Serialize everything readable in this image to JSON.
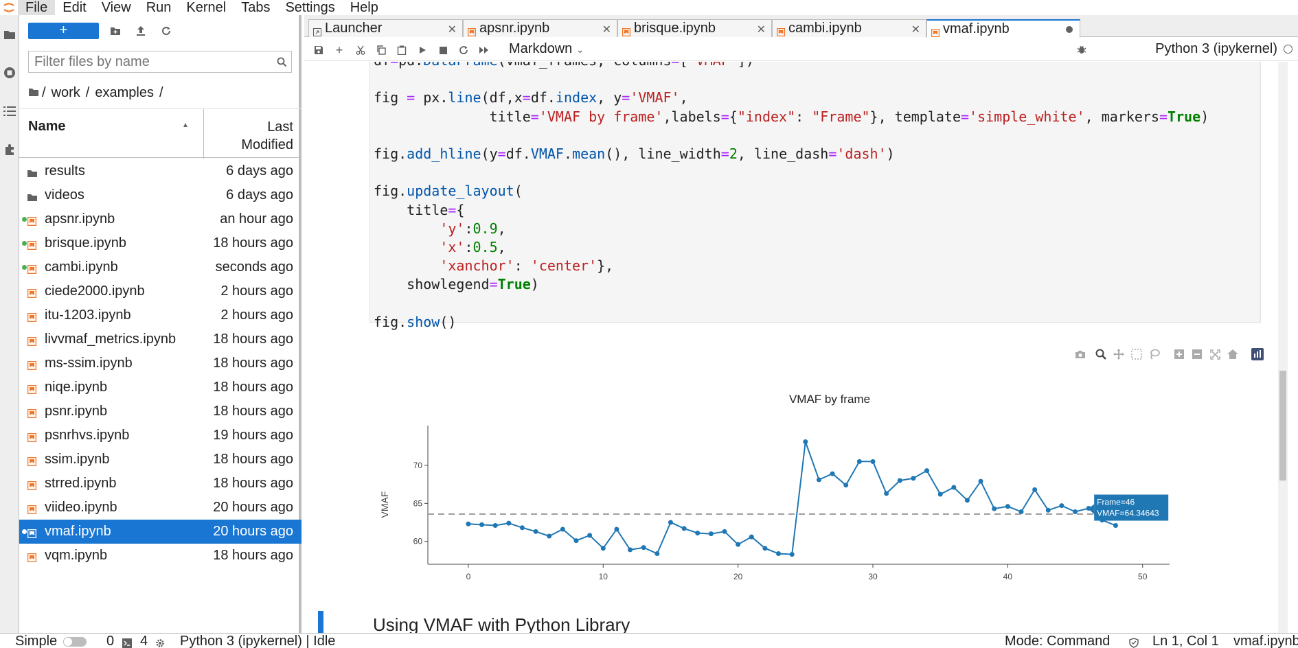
{
  "menubar": {
    "items": [
      "File",
      "Edit",
      "View",
      "Run",
      "Kernel",
      "Tabs",
      "Settings",
      "Help"
    ]
  },
  "filebrowser": {
    "new_label": "+",
    "filter_placeholder": "Filter files by name",
    "breadcrumb": [
      "/",
      "work",
      "/",
      "examples",
      "/"
    ],
    "header_name": "Name",
    "header_modified_line1": "Last",
    "header_modified_line2": "Modified",
    "rows": [
      {
        "name": "results",
        "modified": "6 days ago",
        "type": "folder",
        "running": false
      },
      {
        "name": "videos",
        "modified": "6 days ago",
        "type": "folder",
        "running": false
      },
      {
        "name": "apsnr.ipynb",
        "modified": "an hour ago",
        "type": "notebook",
        "running": true
      },
      {
        "name": "brisque.ipynb",
        "modified": "18 hours ago",
        "type": "notebook",
        "running": true
      },
      {
        "name": "cambi.ipynb",
        "modified": "seconds ago",
        "type": "notebook",
        "running": true
      },
      {
        "name": "ciede2000.ipynb",
        "modified": "2 hours ago",
        "type": "notebook",
        "running": false
      },
      {
        "name": "itu-1203.ipynb",
        "modified": "2 hours ago",
        "type": "notebook",
        "running": false
      },
      {
        "name": "livvmaf_metrics.ipynb",
        "modified": "18 hours ago",
        "type": "notebook",
        "running": false
      },
      {
        "name": "ms-ssim.ipynb",
        "modified": "18 hours ago",
        "type": "notebook",
        "running": false
      },
      {
        "name": "niqe.ipynb",
        "modified": "18 hours ago",
        "type": "notebook",
        "running": false
      },
      {
        "name": "psnr.ipynb",
        "modified": "18 hours ago",
        "type": "notebook",
        "running": false
      },
      {
        "name": "psnrhvs.ipynb",
        "modified": "19 hours ago",
        "type": "notebook",
        "running": false
      },
      {
        "name": "ssim.ipynb",
        "modified": "18 hours ago",
        "type": "notebook",
        "running": false
      },
      {
        "name": "strred.ipynb",
        "modified": "18 hours ago",
        "type": "notebook",
        "running": false
      },
      {
        "name": "viideo.ipynb",
        "modified": "20 hours ago",
        "type": "notebook",
        "running": false
      },
      {
        "name": "vmaf.ipynb",
        "modified": "20 hours ago",
        "type": "notebook",
        "running": true,
        "selected": true
      },
      {
        "name": "vqm.ipynb",
        "modified": "18 hours ago",
        "type": "notebook",
        "running": false
      }
    ]
  },
  "tabs": [
    {
      "label": "Launcher",
      "active": false
    },
    {
      "label": "apsnr.ipynb",
      "active": false
    },
    {
      "label": "brisque.ipynb",
      "active": false
    },
    {
      "label": "cambi.ipynb",
      "active": false
    },
    {
      "label": "vmaf.ipynb",
      "active": true
    }
  ],
  "notebook_toolbar": {
    "cell_type": "Markdown",
    "kernel": "Python 3 (ipykernel)"
  },
  "code_lines": [
    "df=pd.DataFrame(vmaf_frames, columns=['VMAF'])",
    "",
    "fig = px.line(df,x=df.index, y='VMAF',",
    "              title='VMAF by frame',labels={\"index\": \"Frame\"}, template='simple_white', markers=True)",
    "",
    "fig.add_hline(y=df.VMAF.mean(), line_width=2, line_dash='dash')",
    "",
    "fig.update_layout(",
    "    title={",
    "        'y':0.9,",
    "        'x':0.5,",
    "        'xanchor': 'center'},",
    "    showlegend=True)",
    "",
    "fig.show()"
  ],
  "chart_data": {
    "type": "line",
    "title": "VMAF by frame",
    "xlabel": "Frame",
    "ylabel": "VMAF",
    "x": [
      0,
      1,
      2,
      3,
      4,
      5,
      6,
      7,
      8,
      9,
      10,
      11,
      12,
      13,
      14,
      15,
      16,
      17,
      18,
      19,
      20,
      21,
      22,
      23,
      24,
      25,
      26,
      27,
      28,
      29,
      30,
      31,
      32,
      33,
      34,
      35,
      36,
      37,
      38,
      39,
      40,
      41,
      42,
      43,
      44,
      45,
      46,
      47,
      48
    ],
    "values": [
      62.3,
      62.2,
      62.1,
      62.4,
      61.8,
      61.3,
      60.7,
      61.6,
      60.1,
      60.8,
      59.1,
      61.6,
      58.9,
      59.2,
      58.4,
      62.5,
      61.7,
      61.1,
      61.0,
      61.3,
      59.6,
      60.6,
      59.1,
      58.4,
      58.3,
      73.1,
      68.1,
      68.9,
      67.4,
      70.5,
      70.5,
      66.3,
      68.0,
      68.3,
      69.3,
      66.2,
      67.1,
      65.4,
      67.9,
      64.3,
      64.6,
      63.9,
      66.8,
      64.1,
      64.7,
      63.9,
      64.35,
      62.8,
      62.1
    ],
    "mean_line": 63.6,
    "xlim": [
      -3,
      52
    ],
    "ylim": [
      57.0,
      74.5
    ],
    "xticks": [
      0,
      10,
      20,
      30,
      40,
      50
    ],
    "yticks": [
      60,
      65,
      70
    ],
    "color": "#1f77b4",
    "tooltip_line1": "Frame=46",
    "tooltip_line2": "VMAF=64.34643",
    "legend": "none",
    "grid": false
  },
  "markdown_heading": "Using VMAF with Python Library",
  "statusbar": {
    "mode_label": "Simple",
    "terminals": "0",
    "kernels": "4",
    "kernel_status": "Python 3 (ipykernel) | Idle",
    "mode": "Mode: Command",
    "position": "Ln 1, Col 1",
    "filename": "vmaf.ipynb"
  },
  "colors": {
    "accent": "#1976d2",
    "notebook_icon": "#f37726",
    "running_dot": "#4caf50"
  }
}
